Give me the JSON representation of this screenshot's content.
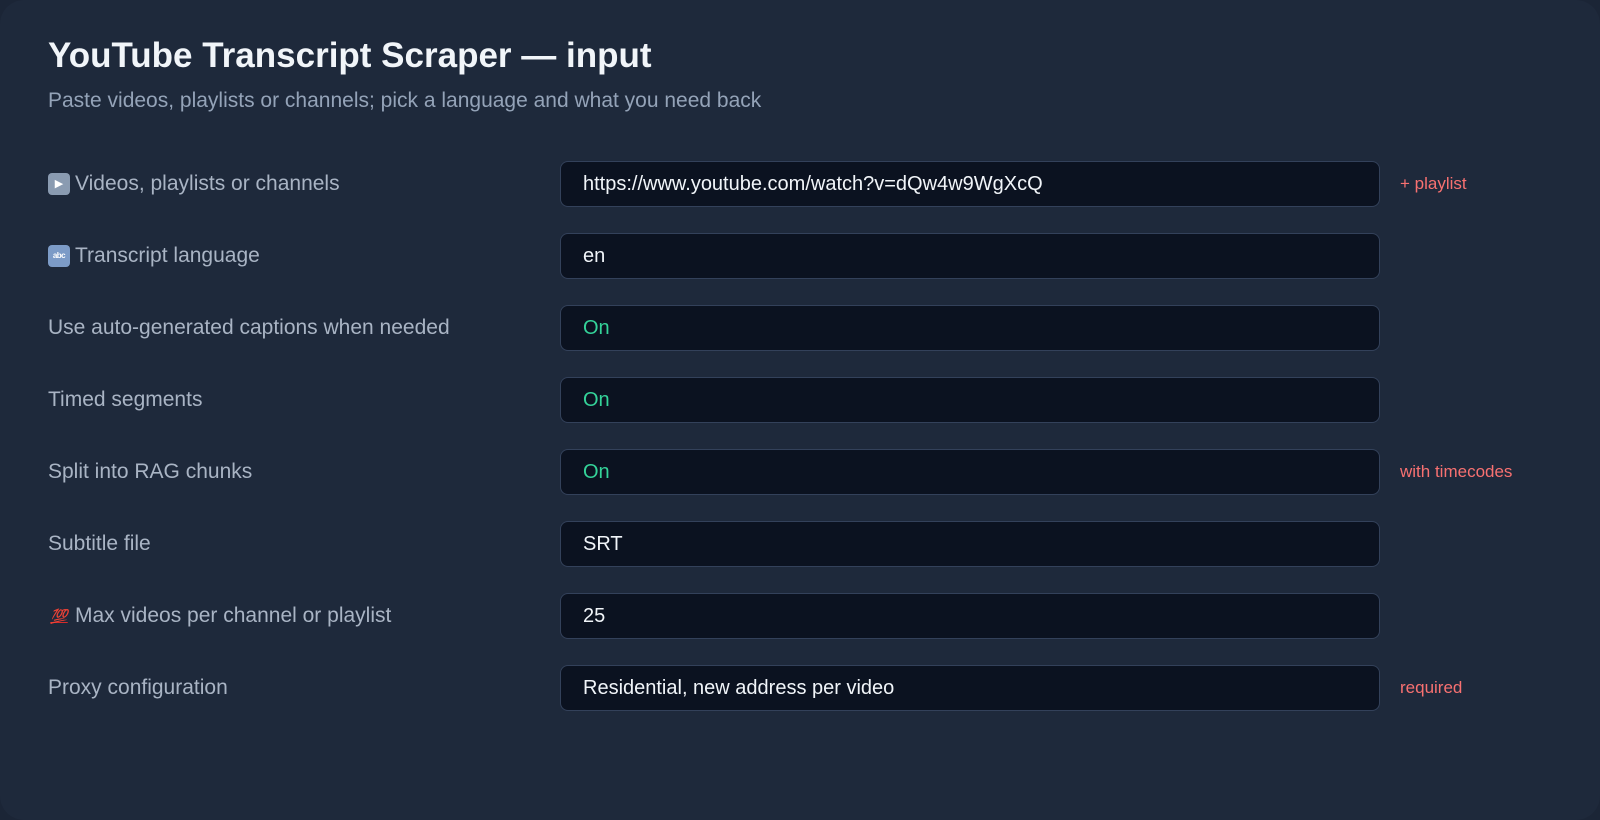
{
  "header": {
    "title": "YouTube Transcript Scraper — input",
    "subtitle": "Paste videos, playlists or channels; pick a language and what you need back"
  },
  "colors": {
    "panel_background": "#1e293b",
    "field_background": "#0b1220",
    "toggle_on": "#34d399",
    "note": "#f87171"
  },
  "fields": {
    "start_urls": {
      "icon": "play-button-icon",
      "label": "Videos, playlists or channels",
      "value": "https://www.youtube.com/watch?v=dQw4w9WgXcQ",
      "note": "+ playlist"
    },
    "language": {
      "icon": "abc-input-icon",
      "label": "Transcript language",
      "value": "en"
    },
    "auto_captions": {
      "label": "Use auto-generated captions when needed",
      "value": "On"
    },
    "timed_segments": {
      "label": "Timed segments",
      "value": "On"
    },
    "rag_chunks": {
      "label": "Split into RAG chunks",
      "value": "On",
      "note": "with timecodes"
    },
    "subtitle_file": {
      "label": "Subtitle file",
      "value": "SRT"
    },
    "max_videos": {
      "icon": "hundred-points-icon",
      "label": "Max videos per channel or playlist",
      "value": "25"
    },
    "proxy": {
      "label": "Proxy configuration",
      "value": "Residential, new address per video",
      "note": "required"
    }
  }
}
